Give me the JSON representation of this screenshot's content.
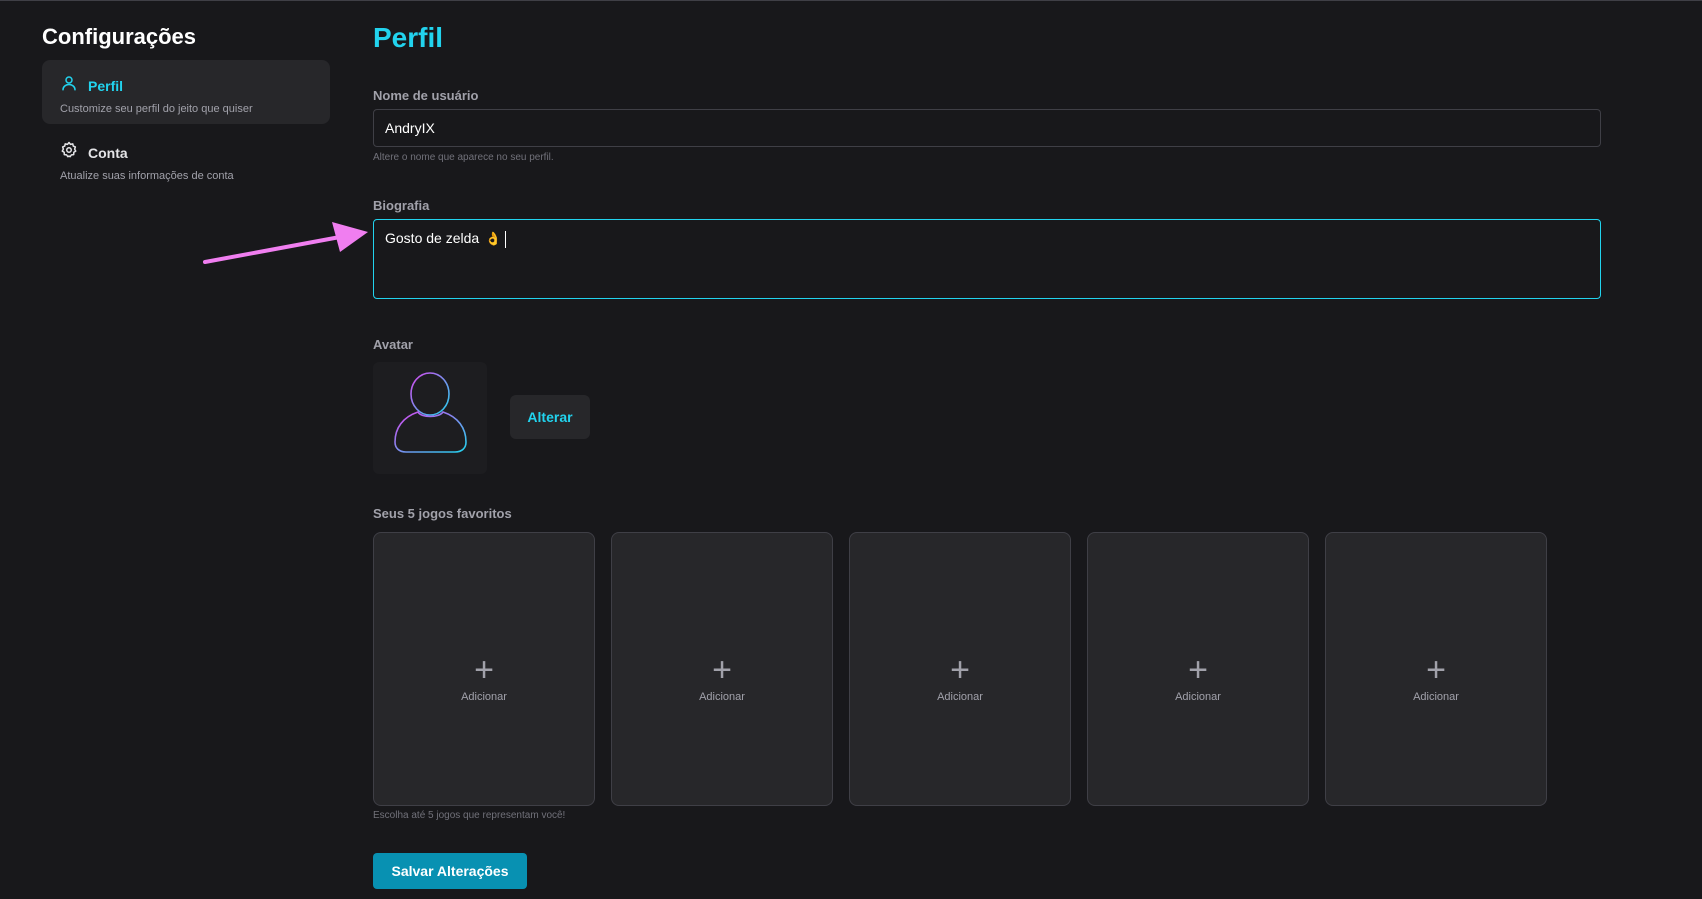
{
  "sidebar": {
    "title": "Configurações",
    "items": [
      {
        "label": "Perfil",
        "description": "Customize seu perfil do jeito que quiser",
        "icon": "user-icon",
        "active": true
      },
      {
        "label": "Conta",
        "description": "Atualize suas informações de conta",
        "icon": "gear-icon",
        "active": false
      }
    ]
  },
  "main": {
    "title": "Perfil",
    "username": {
      "label": "Nome de usuário",
      "value": "AndryIX",
      "hint": "Altere o nome que aparece no seu perfil."
    },
    "bio": {
      "label": "Biografia",
      "value": "Gosto de zelda",
      "emoji": "👌"
    },
    "avatar": {
      "label": "Avatar",
      "change_button": "Alterar",
      "icon": "avatar-placeholder-icon"
    },
    "favorite_games": {
      "label": "Seus 5 jogos favoritos",
      "slots": [
        {
          "add_label": "Adicionar"
        },
        {
          "add_label": "Adicionar"
        },
        {
          "add_label": "Adicionar"
        },
        {
          "add_label": "Adicionar"
        },
        {
          "add_label": "Adicionar"
        }
      ],
      "plus_symbol": "+",
      "hint": "Escolha até 5 jogos que representam você!"
    },
    "save_button": "Salvar Alterações"
  },
  "colors": {
    "background": "#18181b",
    "accent": "#22d3ee",
    "button": "#0891b2",
    "annotation_arrow": "#f07ef0"
  }
}
